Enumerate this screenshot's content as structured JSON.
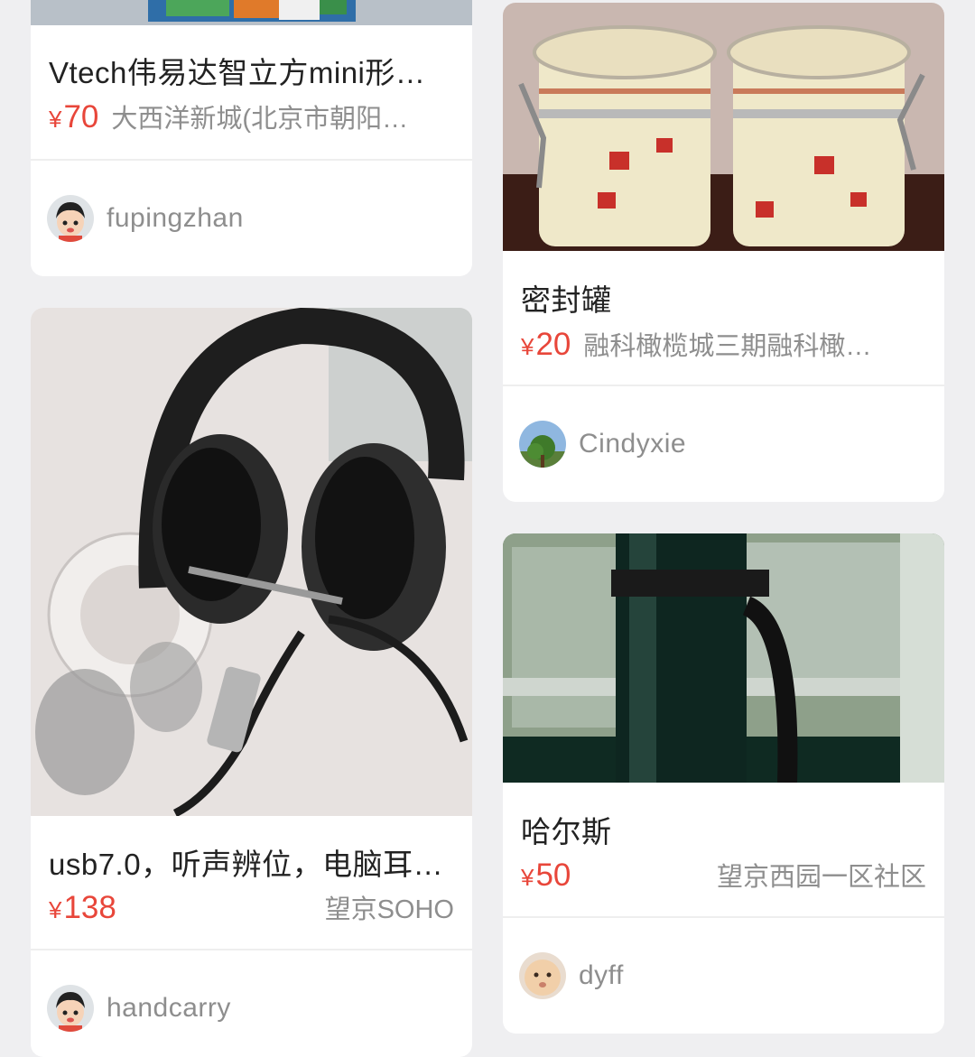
{
  "items": [
    {
      "title": "Vtech伟易达智立方mini形…",
      "currency": "¥",
      "price": "70",
      "location": "大西洋新城(北京市朝阳…",
      "user": "fupingzhan",
      "avatar_icon": "cartoon-boy-avatar-icon"
    },
    {
      "title": "密封罐",
      "currency": "¥",
      "price": "20",
      "location": "融科橄榄城三期融科橄…",
      "user": "Cindyxie",
      "avatar_icon": "tree-photo-avatar-icon"
    },
    {
      "title": "usb7.0，听声辨位，电脑耳…",
      "currency": "¥",
      "price": "138",
      "location": "望京SOHO",
      "user": "handcarry",
      "avatar_icon": "cartoon-boy-avatar-icon"
    },
    {
      "title": "哈尔斯",
      "currency": "¥",
      "price": "50",
      "location": "望京西园一区社区",
      "user": "dyff",
      "avatar_icon": "baby-photo-avatar-icon"
    }
  ]
}
